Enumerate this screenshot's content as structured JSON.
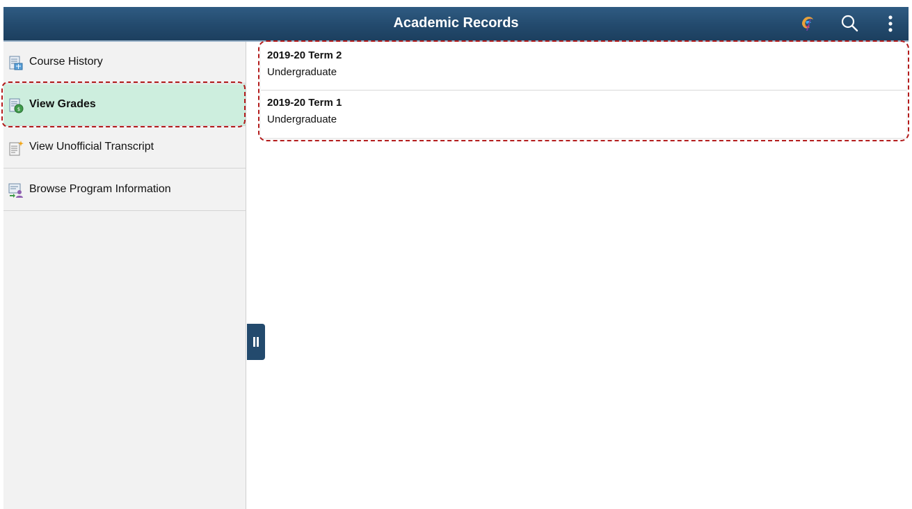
{
  "header": {
    "title": "Academic Records",
    "icons": [
      "branding-icon",
      "search-icon",
      "more-actions-icon"
    ]
  },
  "sidebar": {
    "items": [
      {
        "label": "Course History",
        "icon": "course-history-icon",
        "selected": false
      },
      {
        "label": "View Grades",
        "icon": "view-grades-icon",
        "selected": true
      },
      {
        "label": "View Unofficial Transcript",
        "icon": "transcript-icon",
        "selected": false
      },
      {
        "label": "Browse Program Information",
        "icon": "program-info-icon",
        "selected": false
      }
    ]
  },
  "terms": [
    {
      "term": "2019-20 Term 2",
      "career": "Undergraduate"
    },
    {
      "term": "2019-20 Term 1",
      "career": "Undergraduate"
    }
  ],
  "colors": {
    "header": "#234a6d",
    "selected_bg": "#cdeede",
    "sidebar_bg": "#f2f2f2",
    "highlight_border": "#b31b1b"
  }
}
